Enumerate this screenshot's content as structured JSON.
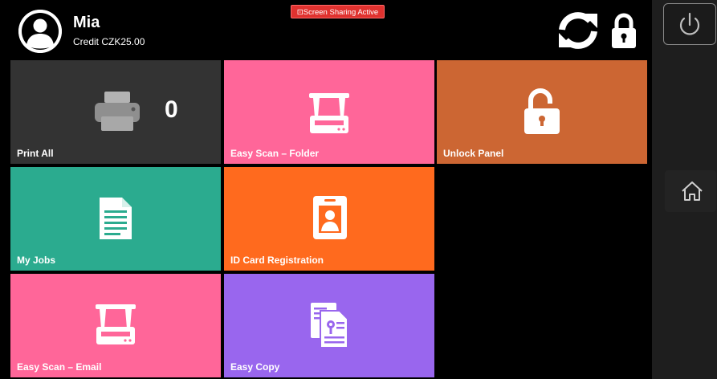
{
  "header": {
    "user_name": "Mia",
    "credit": "Credit CZK25.00",
    "sharing_badge": "⊡Screen Sharing Active",
    "icons": [
      "user-avatar-icon",
      "refresh-icon",
      "lock-icon"
    ]
  },
  "tiles": [
    {
      "label": "Print All",
      "icon": "printer-icon",
      "count": "0",
      "color": "#333333"
    },
    {
      "label": "Easy Scan – Folder",
      "icon": "scanner-icon",
      "color": "#ff6699"
    },
    {
      "label": "Unlock Panel",
      "icon": "unlocked-padlock-icon",
      "color": "#cc6633"
    },
    {
      "label": "My Jobs",
      "icon": "document-icon",
      "color": "#2bab8f"
    },
    {
      "label": "ID Card Registration",
      "icon": "id-card-icon",
      "color": "#ff6a1e"
    },
    {
      "label": "Easy Scan – Email",
      "icon": "scanner-icon",
      "color": "#ff6699"
    },
    {
      "label": "Easy Copy",
      "icon": "copy-documents-icon",
      "color": "#9966ee"
    }
  ],
  "rail": {
    "icons": [
      "power-icon",
      "home-icon"
    ]
  }
}
